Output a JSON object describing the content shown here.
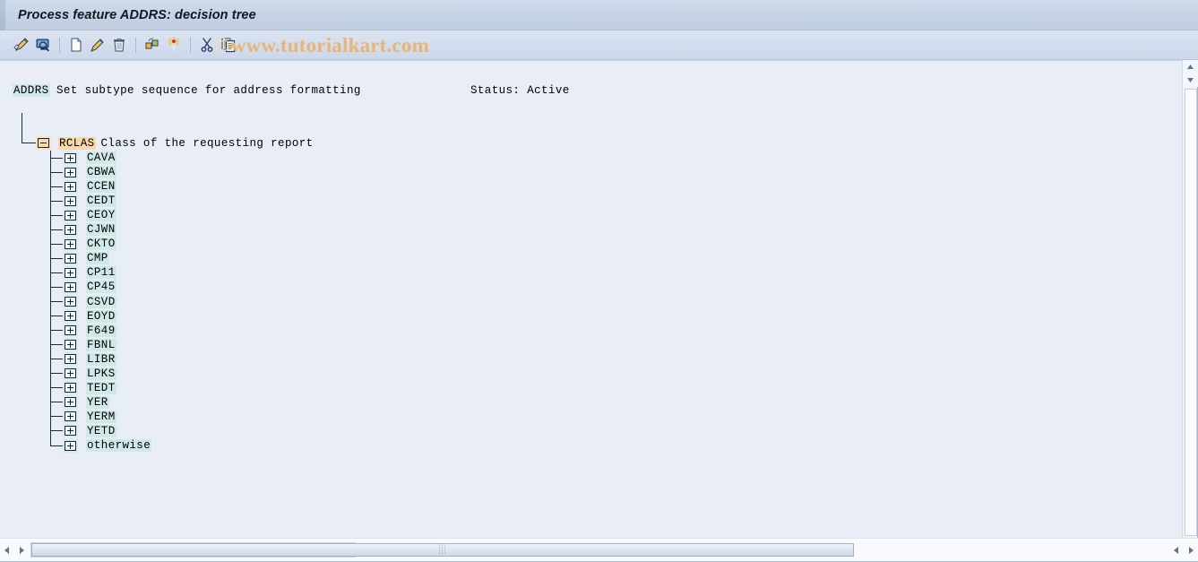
{
  "window": {
    "title": "Process feature ADDRS: decision tree"
  },
  "toolbar": {
    "buttons": [
      {
        "name": "change-mode-icon",
        "label": "Change"
      },
      {
        "name": "display-mode-icon",
        "label": "Display"
      },
      {
        "name": "create-node-icon",
        "label": "Create"
      },
      {
        "name": "change-node-icon",
        "label": "Change node"
      },
      {
        "name": "delete-node-icon",
        "label": "Delete node"
      },
      {
        "name": "structure-icon",
        "label": "Structure"
      },
      {
        "name": "magic-wand-icon",
        "label": "Generate"
      },
      {
        "name": "cut-icon",
        "label": "Cut"
      },
      {
        "name": "copy-icon",
        "label": "Copy"
      }
    ]
  },
  "watermark": {
    "copyright": "©",
    "text": "www.tutorialkart.com"
  },
  "feature": {
    "key": "ADDRS",
    "description": "Set subtype sequence for address formatting",
    "status": "Status: Active"
  },
  "tree": {
    "decision_field": {
      "key": "RCLAS",
      "description": "Class of the requesting report",
      "expanded": true
    },
    "children": [
      {
        "label": "CAVA"
      },
      {
        "label": "CBWA"
      },
      {
        "label": "CCEN"
      },
      {
        "label": "CEDT"
      },
      {
        "label": "CEOY"
      },
      {
        "label": "CJWN"
      },
      {
        "label": "CKTO"
      },
      {
        "label": "CMP"
      },
      {
        "label": "CP11"
      },
      {
        "label": "CP45"
      },
      {
        "label": "CSVD"
      },
      {
        "label": "EOYD"
      },
      {
        "label": "F649"
      },
      {
        "label": "FBNL"
      },
      {
        "label": "LIBR"
      },
      {
        "label": "LPKS"
      },
      {
        "label": "TEDT"
      },
      {
        "label": "YER"
      },
      {
        "label": "YERM"
      },
      {
        "label": "YETD"
      },
      {
        "label": "otherwise"
      }
    ]
  },
  "scrollbars": {
    "vertical_up": "▲",
    "vertical_down": "▼",
    "horizontal_left": "◀",
    "horizontal_right": "▶",
    "grip": "⁞⁞⁞"
  },
  "colors": {
    "content_background": "#e8edf6",
    "titlebar": "#c6d4e5",
    "key_highlight": "#cfe8e8",
    "field_highlight": "#f8d9a8",
    "watermark": "#e8b577",
    "tree_line": "#1b2a3d"
  }
}
